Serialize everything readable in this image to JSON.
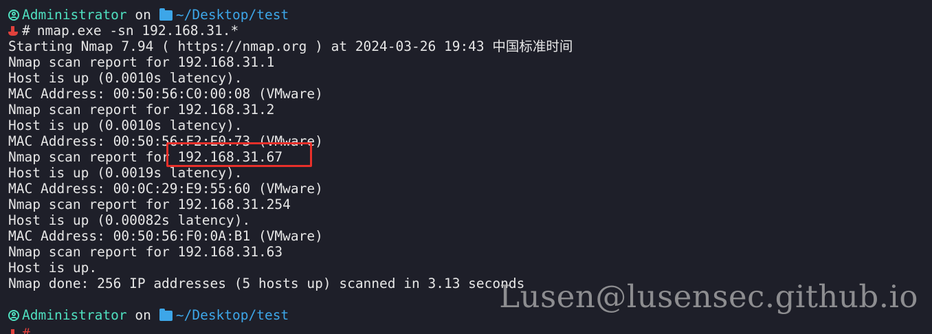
{
  "prompt": {
    "user": "Administrator",
    "on": "on",
    "path": "~/Desktop/test",
    "hash": "#"
  },
  "command": "nmap.exe -sn 192.168.31.*",
  "output": [
    "Starting Nmap 7.94 ( https://nmap.org ) at 2024-03-26 19:43 中国标准时间",
    "Nmap scan report for 192.168.31.1",
    "Host is up (0.0010s latency).",
    "MAC Address: 00:50:56:C0:00:08 (VMware)",
    "Nmap scan report for 192.168.31.2",
    "Host is up (0.0010s latency).",
    "MAC Address: 00:50:56:F2:E0:73 (VMware)",
    "Nmap scan report for 192.168.31.67",
    "Host is up (0.0019s latency).",
    "MAC Address: 00:0C:29:E9:55:60 (VMware)",
    "Nmap scan report for 192.168.31.254",
    "Host is up (0.00082s latency).",
    "MAC Address: 00:50:56:F0:0A:B1 (VMware)",
    "Nmap scan report for 192.168.31.63",
    "Host is up.",
    "Nmap done: 256 IP addresses (5 hosts up) scanned in 3.13 seconds"
  ],
  "watermark": "Lusen@lusensec.github.io",
  "colors": {
    "background": "#1e1f29",
    "prompt_user": "#4fe0c0",
    "prompt_path": "#3da6e8",
    "highlight_box": "#e8302a",
    "ship_icon": "#e0413c"
  },
  "icons": {
    "user": "user-circle-icon",
    "folder": "folder-icon",
    "shell": "ship-icon"
  }
}
